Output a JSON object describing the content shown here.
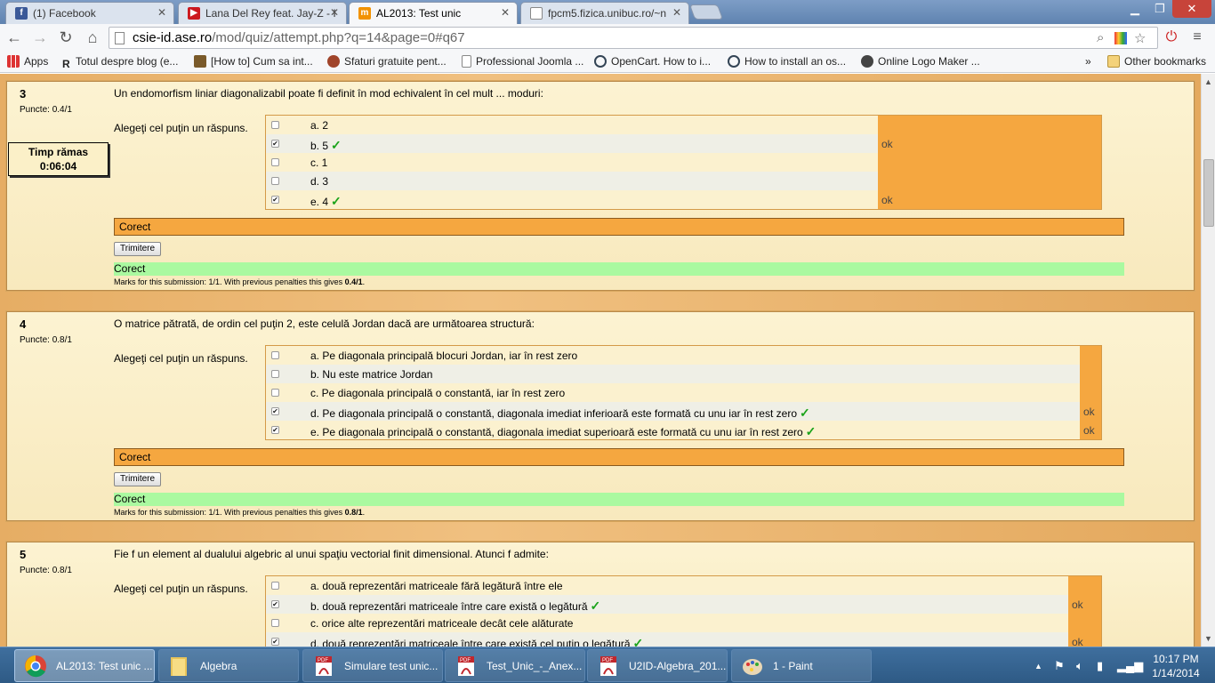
{
  "browser": {
    "tabs": [
      {
        "title": "(1) Facebook",
        "icon": "facebook-icon",
        "color": "#3b5998"
      },
      {
        "title": "Lana Del Rey feat. Jay-Z - I",
        "icon": "youtube-icon",
        "color": "#cc181e"
      },
      {
        "title": "AL2013: Test unic",
        "icon": "moodle-icon",
        "color": "#f29200"
      },
      {
        "title": "fpcm5.fizica.unibuc.ro/~n",
        "icon": "page-icon",
        "color": "#888888"
      }
    ],
    "url_host": "csie-id.ase.ro",
    "url_path": "/mod/quiz/attempt.php?q=14&page=0#q67",
    "bookmarks": [
      {
        "label": "Apps"
      },
      {
        "label": "Totul despre blog (e..."
      },
      {
        "label": "[How to] Cum sa int..."
      },
      {
        "label": "Sfaturi gratuite pent..."
      },
      {
        "label": "Professional Joomla ..."
      },
      {
        "label": "OpenCart. How to i..."
      },
      {
        "label": "How to install an os..."
      },
      {
        "label": "Online Logo Maker ..."
      }
    ],
    "bookmarks_overflow": "»",
    "other_bookmarks": "Other bookmarks"
  },
  "timer": {
    "label": "Timp rămas",
    "value": "0:06:04"
  },
  "questions": [
    {
      "number": "3",
      "points": "Puncte: 0.4/1",
      "text": "Un endomorfism liniar diagonalizabil poate fi definit în mod echivalent în cel mult ... moduri:",
      "prompt": "Alegeţi cel puţin un răspuns.",
      "answers": [
        {
          "label": "a. 2",
          "checked": false,
          "correct": false,
          "feedback": ""
        },
        {
          "label": "b. 5",
          "checked": true,
          "correct": true,
          "feedback": "ok"
        },
        {
          "label": "c. 1",
          "checked": false,
          "correct": false,
          "feedback": ""
        },
        {
          "label": "d. 3",
          "checked": false,
          "correct": false,
          "feedback": ""
        },
        {
          "label": "e. 4",
          "checked": true,
          "correct": true,
          "feedback": "ok"
        }
      ],
      "result": "Corect",
      "submit": "Trimitere",
      "status": "Corect",
      "marks_prefix": "Marks for this submission: 1/1. With previous penalties this gives ",
      "marks_value": "0.4/1",
      "marks_suffix": "."
    },
    {
      "number": "4",
      "points": "Puncte: 0.8/1",
      "text": "O matrice pătrată, de ordin cel puţin 2, este celulă Jordan dacă are următoarea structură:",
      "prompt": "Alegeţi cel puţin un răspuns.",
      "answers": [
        {
          "label": "a. Pe diagonala principală blocuri Jordan, iar în rest zero",
          "checked": false,
          "correct": false,
          "feedback": ""
        },
        {
          "label": "b. Nu este matrice Jordan",
          "checked": false,
          "correct": false,
          "feedback": ""
        },
        {
          "label": "c. Pe diagonala principală o constantă, iar în rest zero",
          "checked": false,
          "correct": false,
          "feedback": ""
        },
        {
          "label": "d. Pe diagonala principală o constantă, diagonala imediat inferioară este formată cu unu iar în rest zero",
          "checked": true,
          "correct": true,
          "feedback": "ok"
        },
        {
          "label": "e. Pe diagonala principală o constantă, diagonala imediat superioară este formată cu unu iar în rest zero",
          "checked": true,
          "correct": true,
          "feedback": "ok"
        }
      ],
      "result": "Corect",
      "submit": "Trimitere",
      "status": "Corect",
      "marks_prefix": "Marks for this submission: 1/1. With previous penalties this gives ",
      "marks_value": "0.8/1",
      "marks_suffix": "."
    },
    {
      "number": "5",
      "points": "Puncte: 0.8/1",
      "text": "Fie f un element al dualului algebric al unui spaţiu vectorial finit dimensional. Atunci f admite:",
      "prompt": "Alegeţi cel puţin un răspuns.",
      "answers": [
        {
          "label": "a. două reprezentări matriceale fără legătură între ele",
          "checked": false,
          "correct": false,
          "feedback": ""
        },
        {
          "label": "b. două reprezentări matriceale între care există o legătură",
          "checked": true,
          "correct": true,
          "feedback": "ok"
        },
        {
          "label": "c. orice alte reprezentări matriceale decât cele alăturate",
          "checked": false,
          "correct": false,
          "feedback": ""
        },
        {
          "label": "d. două reprezentări matriceale între care există cel puţin o legătură",
          "checked": true,
          "correct": true,
          "feedback": "ok"
        }
      ]
    }
  ],
  "taskbar": {
    "items": [
      {
        "label": "AL2013: Test unic ...",
        "icon": "chrome-icon"
      },
      {
        "label": "Algebra",
        "icon": "folder-icon"
      },
      {
        "label": "Simulare test unic...",
        "icon": "pdf-icon"
      },
      {
        "label": "Test_Unic_-_Anex...",
        "icon": "pdf-icon"
      },
      {
        "label": "U2ID-Algebra_201...",
        "icon": "pdf-icon"
      },
      {
        "label": "1 - Paint",
        "icon": "paint-icon"
      }
    ],
    "time": "10:17 PM",
    "date": "1/14/2014"
  }
}
